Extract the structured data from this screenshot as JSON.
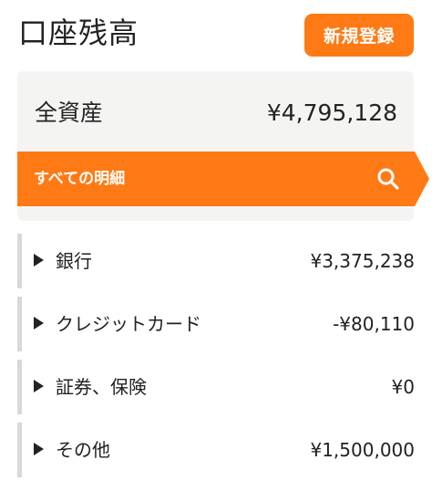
{
  "header": {
    "title": "口座残高",
    "new_button_label": "新規登録"
  },
  "total": {
    "label": "全資産",
    "value": "¥4,795,128"
  },
  "all_details": {
    "label": "すべての明細",
    "icon": "search-icon"
  },
  "accounts": [
    {
      "label": "銀行",
      "value": "¥3,375,238"
    },
    {
      "label": "クレジットカード",
      "value": "-¥80,110"
    },
    {
      "label": "証券、保険",
      "value": "¥0"
    },
    {
      "label": "その他",
      "value": "¥1,500,000"
    }
  ],
  "colors": {
    "accent": "#ff7a14",
    "card_bg": "#f4f5f3",
    "row_border": "#d8d8d8"
  }
}
